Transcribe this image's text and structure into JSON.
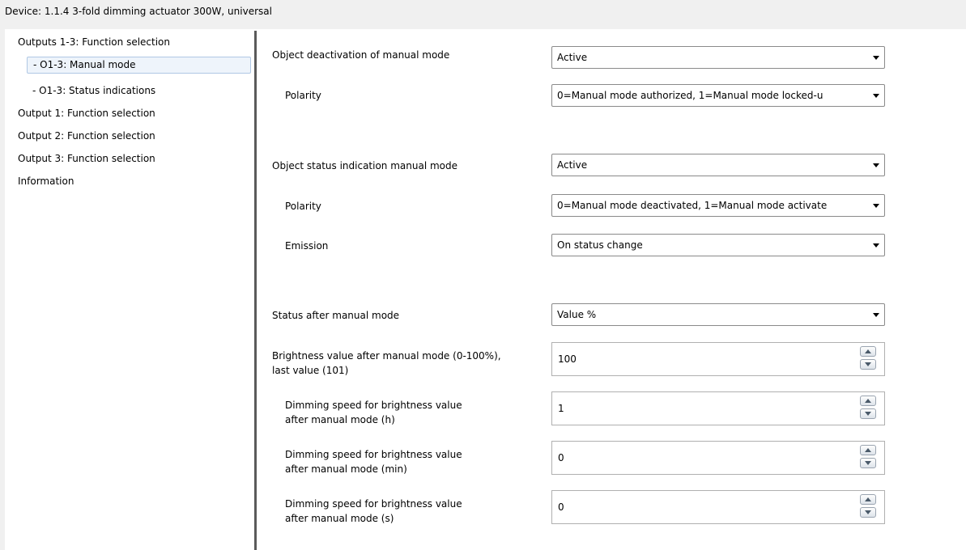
{
  "window": {
    "title": "Device: 1.1.4  3-fold dimming actuator 300W, universal"
  },
  "sidebar": {
    "items": [
      {
        "label": "Outputs 1-3: Function selection",
        "selected": false
      },
      {
        "label": "- O1-3: Manual mode",
        "selected": true
      },
      {
        "label": "- O1-3: Status indications",
        "selected": false
      },
      {
        "label": "Output 1: Function selection",
        "selected": false
      },
      {
        "label": "Output 2: Function selection",
        "selected": false
      },
      {
        "label": "Output 3: Function selection",
        "selected": false
      },
      {
        "label": "Information",
        "selected": false
      }
    ]
  },
  "params": {
    "object_deactivation": {
      "label": "Object deactivation of manual mode",
      "value": "Active"
    },
    "deactivation_polarity": {
      "label": "Polarity",
      "value": "0=Manual mode authorized, 1=Manual mode locked-u"
    },
    "object_status_indication": {
      "label": "Object status indication manual mode",
      "value": "Active"
    },
    "status_polarity": {
      "label": "Polarity",
      "value": "0=Manual mode deactivated, 1=Manual mode activate"
    },
    "emission": {
      "label": "Emission",
      "value": "On status change"
    },
    "status_after_manual": {
      "label": "Status after manual mode",
      "value": "Value %"
    },
    "brightness_value": {
      "label_line1": "Brightness value after manual mode (0-100%),",
      "label_line2": "last value (101)",
      "value": "100"
    },
    "dimming_speed_h": {
      "label_line1": "Dimming speed for brightness value",
      "label_line2": "after manual mode (h)",
      "value": "1"
    },
    "dimming_speed_min": {
      "label_line1": "Dimming speed for brightness value",
      "label_line2": "after manual mode (min)",
      "value": "0"
    },
    "dimming_speed_s": {
      "label_line1": "Dimming speed for brightness value",
      "label_line2": "after manual mode (s)",
      "value": "0"
    }
  },
  "icons": {
    "dropdown": "chevron-down-icon",
    "spin_up": "chevron-up-icon",
    "spin_down": "chevron-down-icon"
  },
  "colors": {
    "selected_item_background": "#eef4fb",
    "selected_item_border": "#b0c8e4",
    "title_bar_background": "#f0f0f0",
    "divider": "#5a5a5a"
  }
}
